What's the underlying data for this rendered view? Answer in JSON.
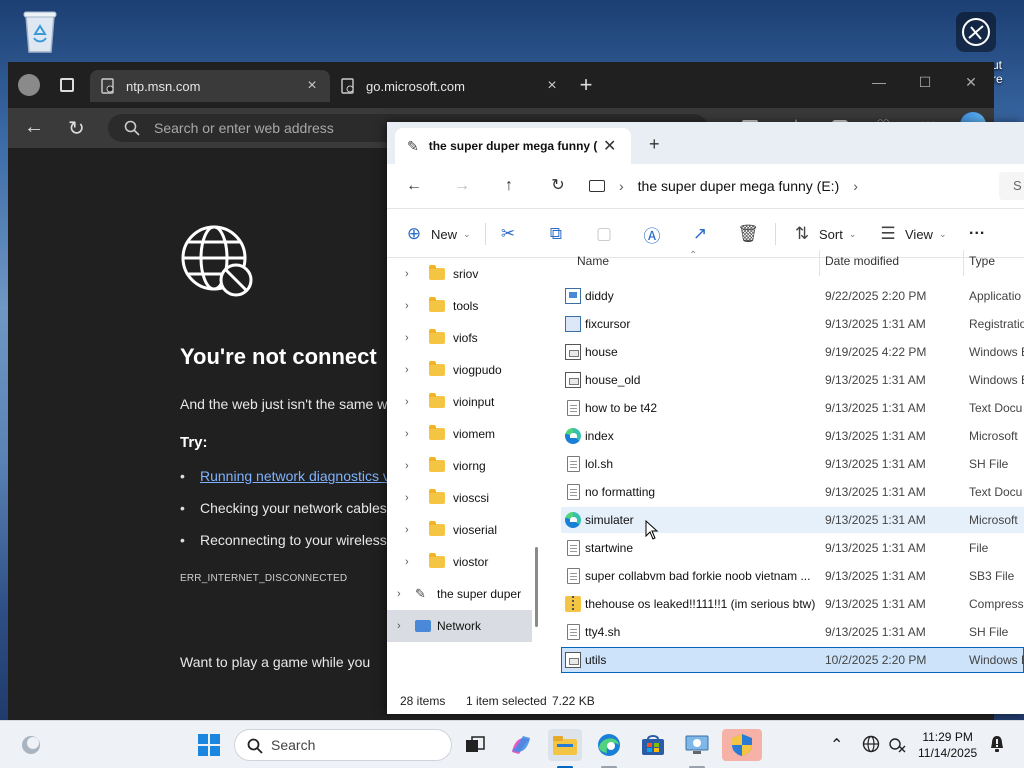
{
  "desktop": {
    "side_text": [
      "ut",
      "re"
    ]
  },
  "edge": {
    "tabs": [
      {
        "label": "ntp.msn.com"
      },
      {
        "label": "go.microsoft.com"
      }
    ],
    "address_placeholder": "Search or enter web address",
    "error": {
      "title": "You're not connect",
      "subtitle": "And the web just isn't the same w",
      "try_label": "Try:",
      "items": [
        "Running network diagnostics v",
        "Checking your network cables,",
        "Reconnecting to your wireless"
      ],
      "code": "ERR_INTERNET_DISCONNECTED",
      "game_text": "Want to play a game while you"
    }
  },
  "explorer": {
    "tab_title": "the super duper mega funny (",
    "path_label": "the super duper mega funny (E:)",
    "search_stub": "S",
    "commands": {
      "new": "New",
      "sort": "Sort",
      "view": "View",
      "more": "..."
    },
    "tree": [
      {
        "label": "sriov"
      },
      {
        "label": "tools"
      },
      {
        "label": "viofs"
      },
      {
        "label": "viogpudo"
      },
      {
        "label": "vioinput"
      },
      {
        "label": "viomem"
      },
      {
        "label": "viorng"
      },
      {
        "label": "vioscsi"
      },
      {
        "label": "vioserial"
      },
      {
        "label": "viostor"
      },
      {
        "label": "the super duper"
      },
      {
        "label": "Network"
      }
    ],
    "columns": {
      "name": "Name",
      "date": "Date modified",
      "type": "Type"
    },
    "files": [
      {
        "name": "diddy",
        "date": "9/22/2025 2:20 PM",
        "type": "Applicatio",
        "icon": "app-icon"
      },
      {
        "name": "fixcursor",
        "date": "9/13/2025 1:31 AM",
        "type": "Registratio",
        "icon": "registry-icon"
      },
      {
        "name": "house",
        "date": "9/19/2025 4:22 PM",
        "type": "Windows B",
        "icon": "batch-icon"
      },
      {
        "name": "house_old",
        "date": "9/13/2025 1:31 AM",
        "type": "Windows B",
        "icon": "batch-icon"
      },
      {
        "name": "how to be t42",
        "date": "9/13/2025 1:31 AM",
        "type": "Text Docu",
        "icon": "text-doc-icon"
      },
      {
        "name": "index",
        "date": "9/13/2025 1:31 AM",
        "type": "Microsoft",
        "icon": "edge-html-icon"
      },
      {
        "name": "lol.sh",
        "date": "9/13/2025 1:31 AM",
        "type": "SH File",
        "icon": "file-icon"
      },
      {
        "name": "no formatting",
        "date": "9/13/2025 1:31 AM",
        "type": "Text Docu",
        "icon": "text-doc-icon"
      },
      {
        "name": "simulater",
        "date": "9/13/2025 1:31 AM",
        "type": "Microsoft",
        "icon": "edge-html-icon"
      },
      {
        "name": "startwine",
        "date": "9/13/2025 1:31 AM",
        "type": "File",
        "icon": "file-icon"
      },
      {
        "name": "super collabvm bad forkie noob vietnam ...",
        "date": "9/13/2025 1:31 AM",
        "type": "SB3 File",
        "icon": "file-icon"
      },
      {
        "name": "thehouse os leaked!!111!!1 (im serious btw)",
        "date": "9/13/2025 1:31 AM",
        "type": "Compresse",
        "icon": "zip-icon"
      },
      {
        "name": "tty4.sh",
        "date": "9/13/2025 1:31 AM",
        "type": "SH File",
        "icon": "file-icon"
      },
      {
        "name": "utils",
        "date": "10/2/2025 2:20 PM",
        "type": "Windows B",
        "icon": "batch-icon"
      }
    ],
    "status": {
      "count": "28 items",
      "selected": "1 item selected",
      "size": "7.22 KB"
    }
  },
  "taskbar": {
    "search_label": "Search",
    "time": "11:29 PM",
    "date": "11/14/2025"
  },
  "colors": {
    "accent": "#0067c0",
    "edge_bg": "#202020",
    "link": "#7fb2ff"
  }
}
